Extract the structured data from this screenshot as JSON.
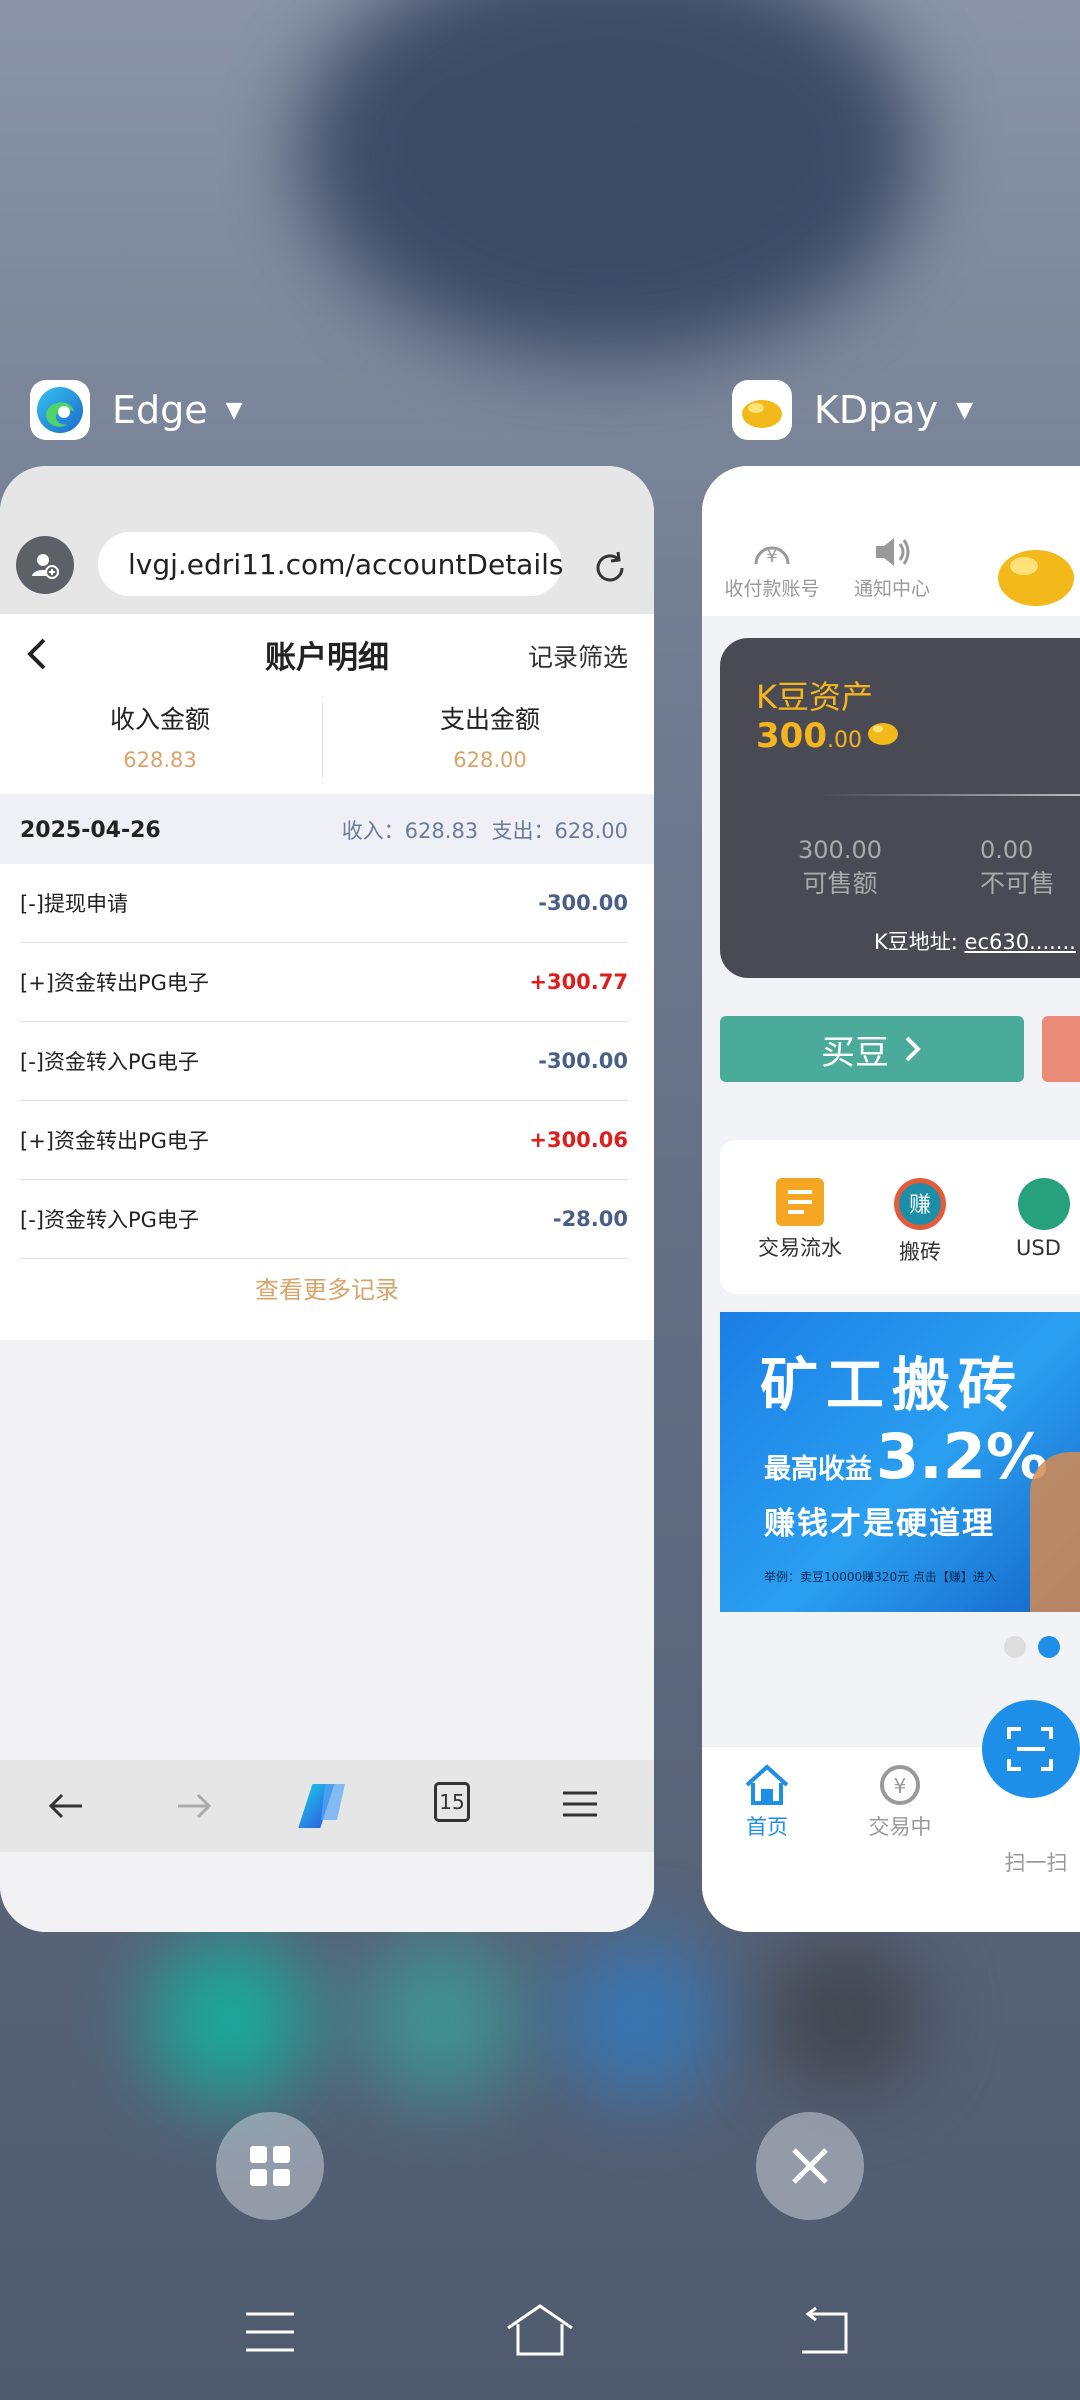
{
  "edge_app": {
    "name": "Edge"
  },
  "kdpay_app": {
    "name": "KDpay"
  },
  "edge_page": {
    "url": "lvgj.edri11.com/accountDetails",
    "title": "账户明细",
    "filter_label": "记录筛选",
    "income_label": "收入金额",
    "income_value": "628.83",
    "expense_label": "支出金额",
    "expense_value": "628.00",
    "date": "2025-04-26",
    "day_summary": "收入：628.83  支出：628.00",
    "records": [
      {
        "label": "[-]提现申请",
        "amount": "-300.00"
      },
      {
        "label": "[+]资金转出PG电子",
        "amount": "+300.77"
      },
      {
        "label": "[-]资金转入PG电子",
        "amount": "-300.00"
      },
      {
        "label": "[+]资金转出PG电子",
        "amount": "+300.06"
      },
      {
        "label": "[-]资金转入PG电子",
        "amount": "-28.00"
      }
    ],
    "more_records": "查看更多记录",
    "tab_count": "15"
  },
  "kdpay_page": {
    "top_items": [
      {
        "label": "收付款账号"
      },
      {
        "label": "通知中心"
      }
    ],
    "asset_title": "K豆资产",
    "asset_amount_int": "300",
    "asset_amount_dec": ".00",
    "sellable_value": "300.00",
    "sellable_label": "可售额",
    "unsellable_value": "0.00",
    "unsellable_label": "不可售",
    "address_label": "K豆地址:",
    "address_value": "ec630.......",
    "buy_button": "买豆",
    "shortcuts": [
      {
        "label": "交易流水"
      },
      {
        "label": "搬砖"
      },
      {
        "label": "USD"
      }
    ],
    "banner_title": "矿工搬砖",
    "banner_line1_prefix": "最高收益",
    "banner_line1_value": "3.2%",
    "banner_line2": "赚钱才是硬道理",
    "banner_footnote": "举例：卖豆10000赚320元  点击【赚】进入",
    "nav": [
      {
        "label": "首页"
      },
      {
        "label": "交易中"
      },
      {
        "label": "扫一扫"
      }
    ],
    "accent_blue": "#1e8fe8",
    "accent_gold": "#f5b51c",
    "buy_green": "#4aab9a"
  }
}
